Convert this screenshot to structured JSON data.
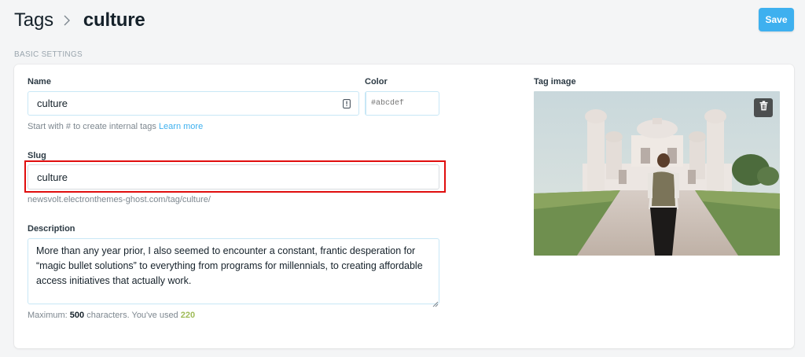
{
  "header": {
    "breadcrumb_root": "Tags",
    "breadcrumb_current": "culture",
    "save_label": "Save"
  },
  "section": {
    "title": "BASIC SETTINGS"
  },
  "form": {
    "name": {
      "label": "Name",
      "value": "culture",
      "hint": "Start with # to create internal tags",
      "hint_link": "Learn more"
    },
    "color": {
      "label": "Color",
      "placeholder": "#abcdef",
      "value": ""
    },
    "slug": {
      "label": "Slug",
      "value": "culture",
      "url": "newsvolt.electronthemes-ghost.com/tag/culture/"
    },
    "description": {
      "label": "Description",
      "value": "More than any year prior, I also seemed to encounter a constant, frantic desperation for “magic bullet solutions” to everything from programs for millennials, to creating affordable access initiatives that actually work.",
      "counter_prefix": "Maximum:",
      "max": "500",
      "counter_middle": "characters. You've used",
      "used": "220"
    },
    "tag_image": {
      "label": "Tag image",
      "icon": "trash-icon"
    }
  },
  "colors": {
    "accent": "#3eb0ef",
    "highlight": "#e00d0d",
    "used_count": "#9fbb58"
  }
}
